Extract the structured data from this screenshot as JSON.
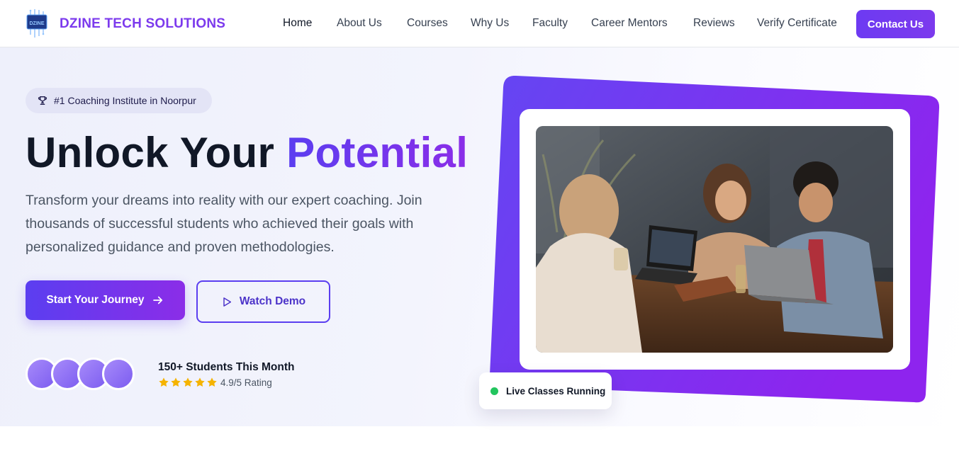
{
  "brand": {
    "name": "DZINE TECH SOLUTIONS",
    "logo_text": "DZINE",
    "logo_icon": "circuit-chip-logo"
  },
  "nav": {
    "items": [
      {
        "label": "Home"
      },
      {
        "label": "About Us"
      },
      {
        "label": "Courses"
      },
      {
        "label": "Why Us"
      },
      {
        "label": "Faculty"
      },
      {
        "label": "Career Mentors"
      },
      {
        "label": "Reviews"
      },
      {
        "label": "Verify Certificate"
      }
    ],
    "active": "Home",
    "cta_label": "Contact Us"
  },
  "hero": {
    "badge": {
      "icon": "trophy-icon",
      "text": "#1 Coaching Institute in Noorpur"
    },
    "headline_plain": "Unlock Your",
    "headline_accent": "Potential",
    "subtext": "Transform your dreams into reality with our expert coaching. Join thousands of successful students who achieved their goals with personalized guidance and proven methodologies.",
    "primary_cta": {
      "label": "Start Your Journey",
      "icon": "arrow-right-icon"
    },
    "secondary_cta": {
      "label": "Watch Demo",
      "icon": "play-icon"
    },
    "social_proof": {
      "avatar_count": 4,
      "students": "150+ Students This Month",
      "stars": 5,
      "rating": "4.9/5 Rating"
    },
    "live_badge": "Live Classes Running",
    "photo": "students-studying-with-laptops-photo"
  },
  "colors": {
    "accent": "#6d3af2",
    "accent_end": "#8b2de8",
    "brand": "#7c3aed",
    "star": "#f5b301",
    "live": "#22c55e"
  }
}
